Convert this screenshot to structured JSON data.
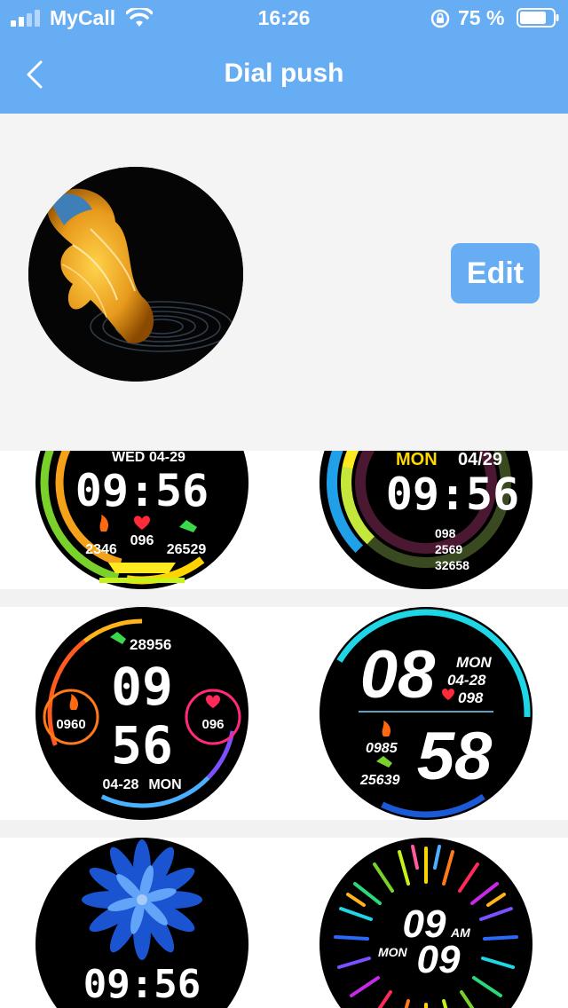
{
  "status_bar": {
    "carrier": "MyCall",
    "time": "16:26",
    "battery": "75 %",
    "icons": [
      "signal-icon",
      "wifi-icon",
      "rotation-lock-icon",
      "battery-icon"
    ]
  },
  "nav": {
    "title": "Dial push",
    "back_icon": "chevron-left-icon"
  },
  "current_dial": {
    "image": "betta-fish-dial",
    "edit_label": "Edit"
  },
  "dials": [
    {
      "id": "rainbow-rings",
      "day": "WED",
      "date": "04-29",
      "time": "09:56",
      "calories": "2346",
      "heart": "096",
      "steps": "26529"
    },
    {
      "id": "activity-arcs",
      "day": "MON",
      "date": "04/29",
      "time": "09:56",
      "heart": "098",
      "calories": "2569",
      "steps": "32658"
    },
    {
      "id": "gradient-ring",
      "steps": "28956",
      "hour": "09",
      "minute": "56",
      "calories": "0960",
      "heart": "096",
      "date": "04-28",
      "day": "MON"
    },
    {
      "id": "italic-bold",
      "hour": "08",
      "minute": "58",
      "day": "MON",
      "date": "04-28",
      "heart": "098",
      "calories": "0985",
      "steps": "25639"
    },
    {
      "id": "blue-flower",
      "time": "09:56"
    },
    {
      "id": "color-burst",
      "hour": "09",
      "ampm": "AM",
      "day": "MON",
      "minute": "09"
    }
  ],
  "colors": {
    "header": "#66adf4",
    "accent_cyan": "#1fd6e6",
    "ring_orange": "#f5a11a",
    "ring_green": "#7bd12b"
  }
}
